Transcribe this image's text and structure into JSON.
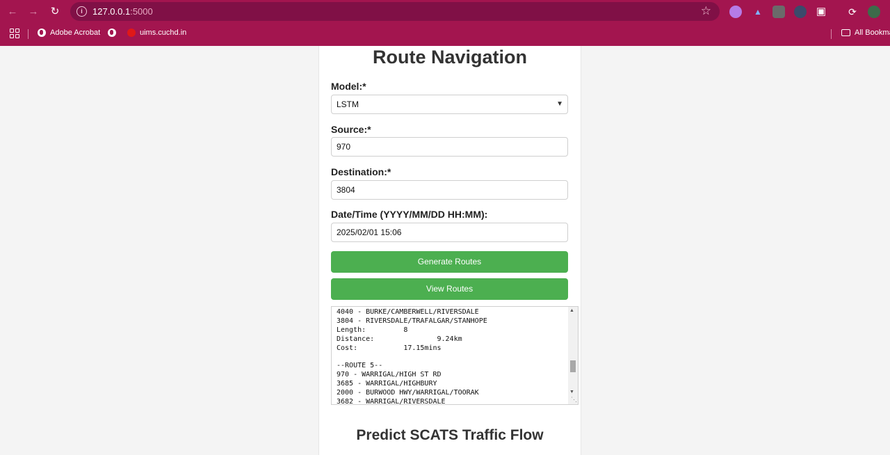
{
  "browser": {
    "url_host": "127.0.0.1",
    "url_port": ":5000",
    "bookmarks": [
      {
        "label": "Adobe Acrobat"
      },
      {
        "label": ""
      },
      {
        "label": "uims.cuchd.in"
      }
    ],
    "all_bookmarks_label": "All Bookma"
  },
  "page": {
    "title": "Route Navigation",
    "model_label": "Model:*",
    "model_value": "LSTM",
    "source_label": "Source:*",
    "source_value": "970",
    "destination_label": "Destination:*",
    "destination_value": "3804",
    "datetime_label": "Date/Time (YYYY/MM/DD HH:MM):",
    "datetime_value": "2025/02/01 15:06",
    "generate_button": "Generate Routes",
    "view_button": "View Routes",
    "output_lines": [
      "4040 - BURKE/CAMBERWELL/RIVERSDALE",
      "3804 - RIVERSDALE/TRAFALGAR/STANHOPE",
      "Length:         8",
      "Distance:               9.24km",
      "Cost:           17.15mins",
      "",
      "--ROUTE 5--",
      "970 - WARRIGAL/HIGH ST RD",
      "3685 - WARRIGAL/HIGHBURY",
      "2000 - BURWOOD HWY/WARRIGAL/TOORAK",
      "3682 - WARRIGAL/RIVERSDALE"
    ],
    "subtitle": "Predict SCATS Traffic Flow"
  },
  "colors": {
    "browser_chrome": "#a3154f",
    "omnibox": "#801046",
    "button_green": "#4caf50",
    "page_bg": "#f4f4f4"
  }
}
